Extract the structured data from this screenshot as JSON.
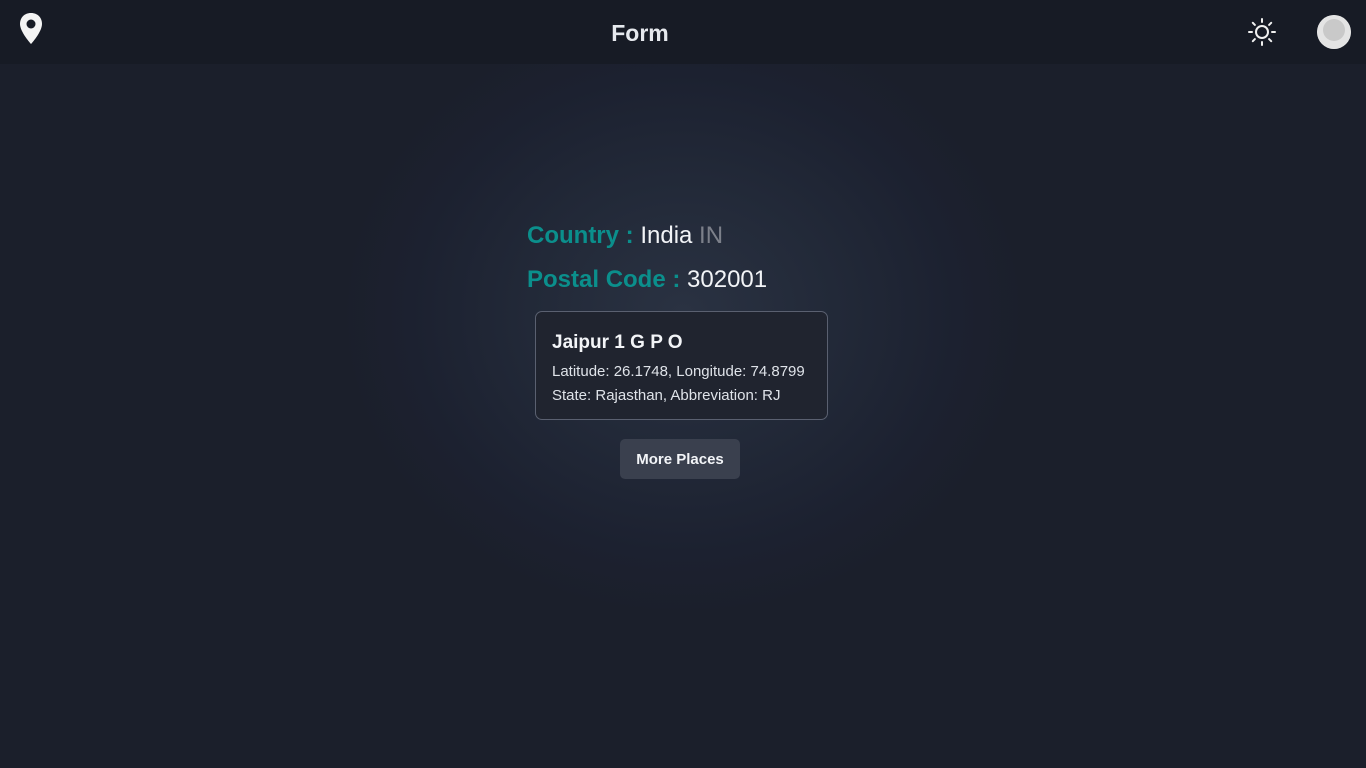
{
  "header": {
    "title": "Form",
    "logo_icon": "map-pin-icon",
    "theme_icon": "sun-icon",
    "avatar_icon": "user-avatar"
  },
  "location": {
    "country_label": "Country :",
    "country_name": "India",
    "country_code": "IN",
    "postal_label": "Postal Code :",
    "postal_code": "302001"
  },
  "place": {
    "name": "Jaipur 1 G P O",
    "coordinates": "Latitude: 26.1748, Longitude: 74.8799",
    "state": "State: Rajasthan, Abbreviation: RJ"
  },
  "actions": {
    "more_places_label": "More Places"
  },
  "colors": {
    "accent": "#0b8f8c",
    "background": "#1b1f2b",
    "header": "#171b25",
    "button": "#3a404e"
  }
}
